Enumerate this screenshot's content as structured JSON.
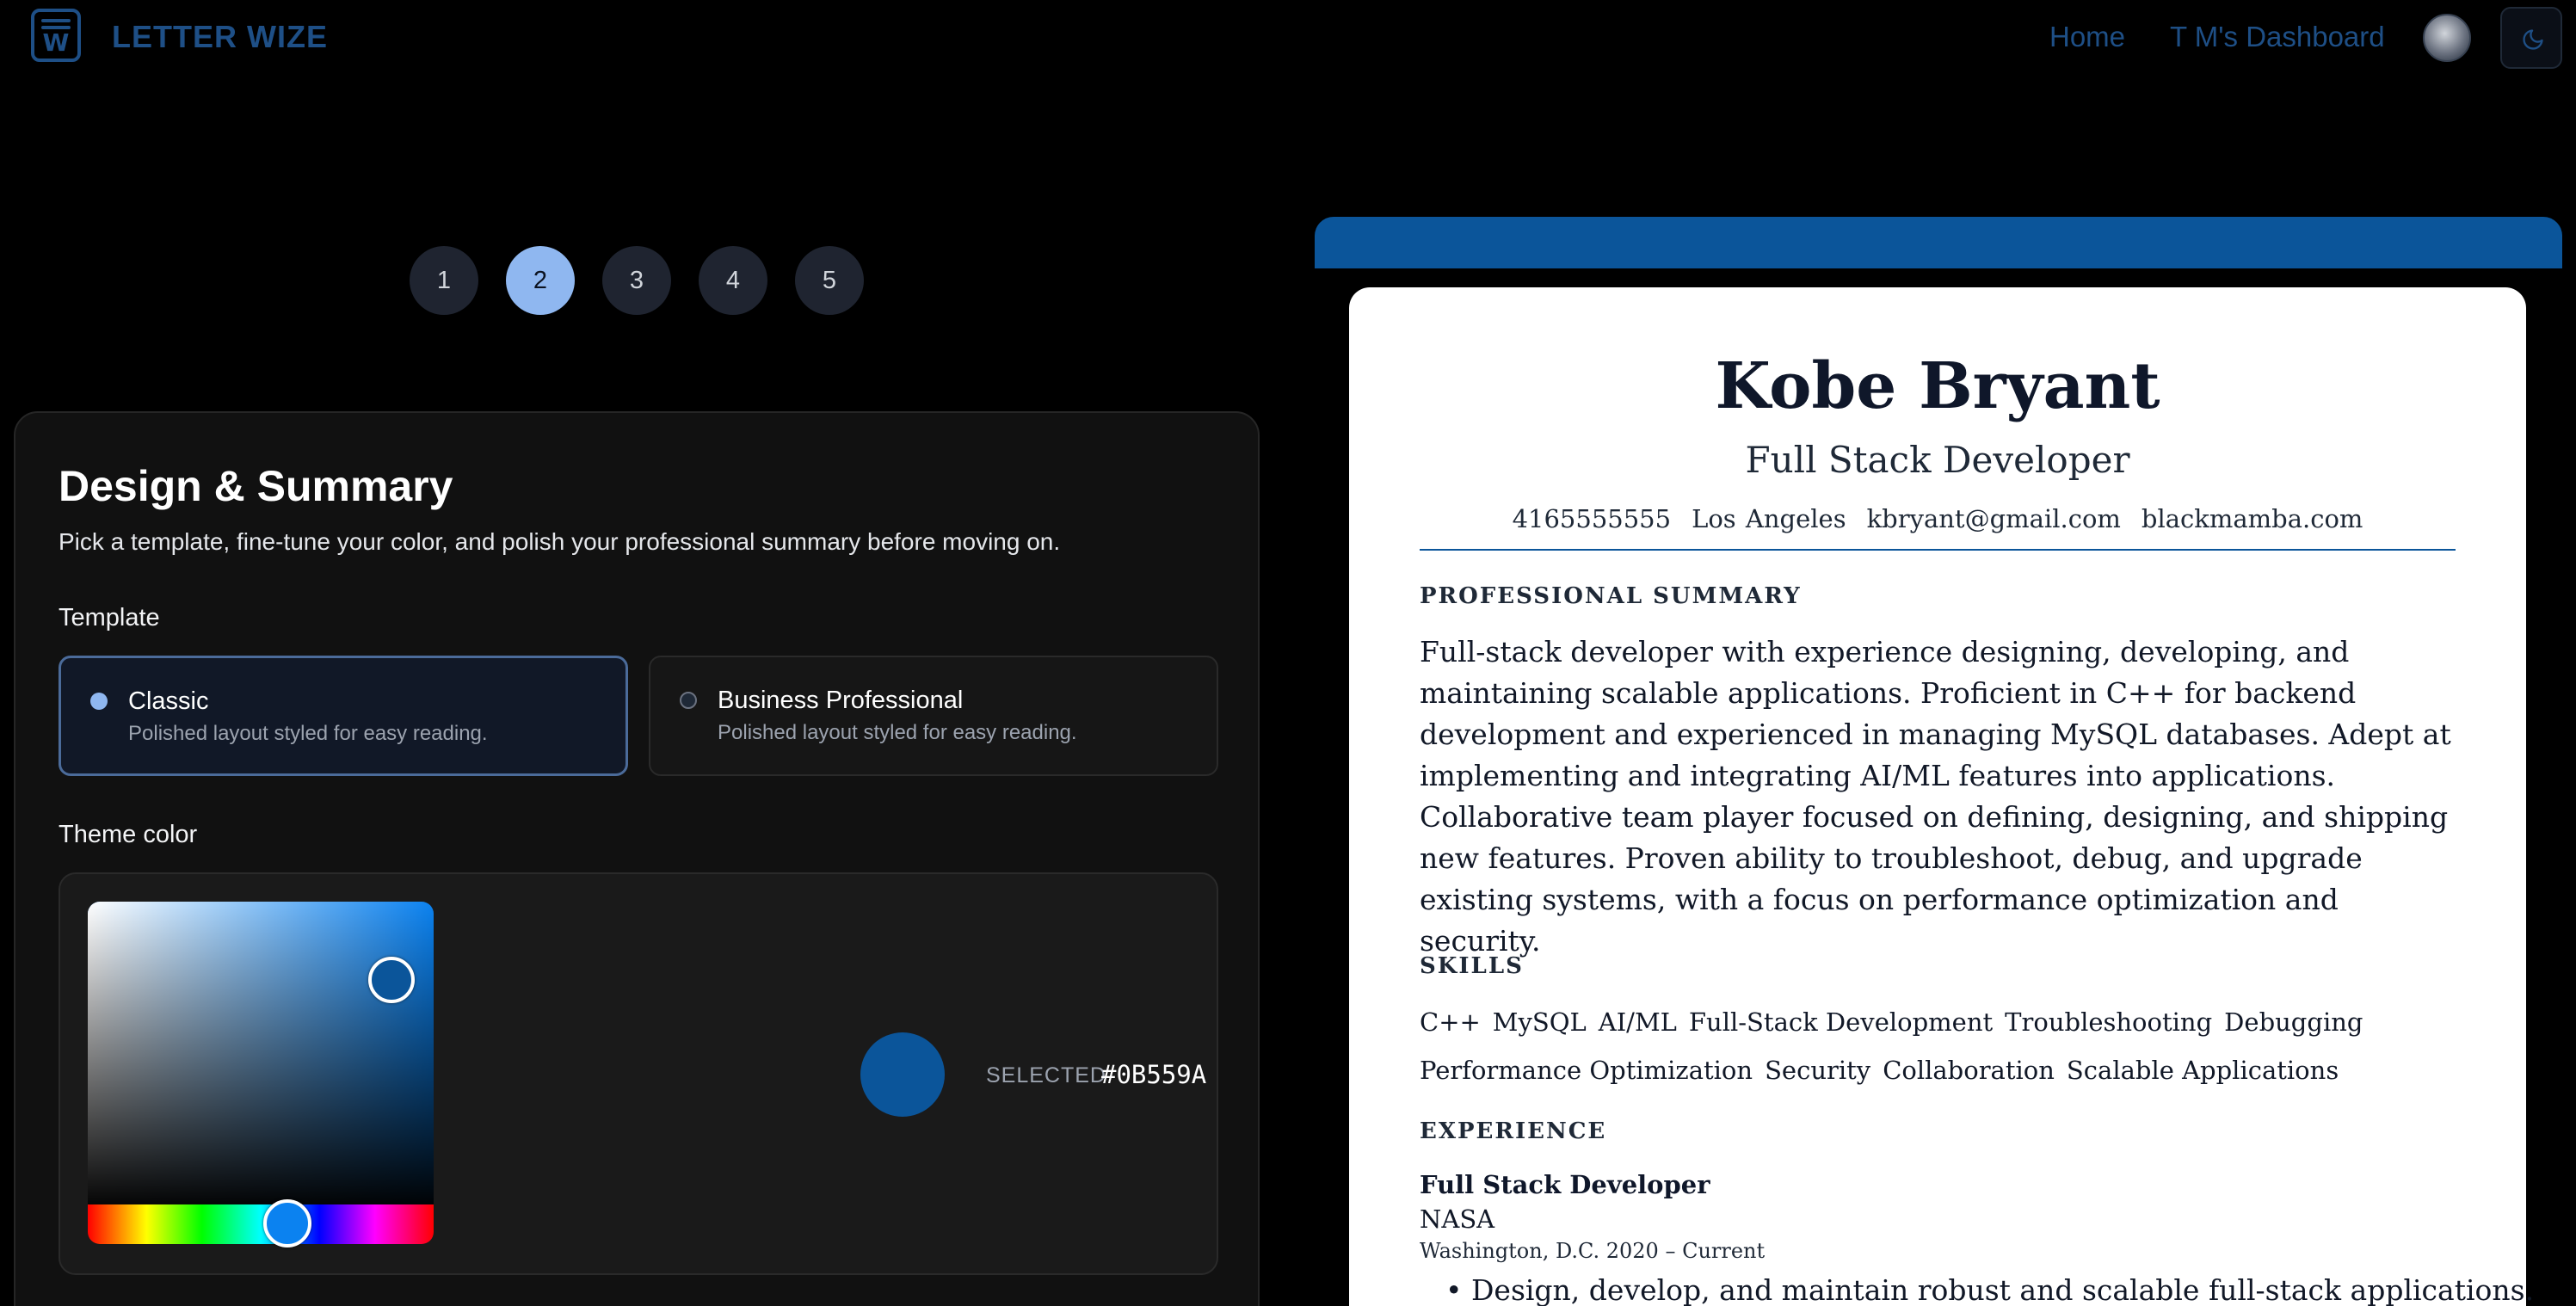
{
  "header": {
    "logo_letter": "W",
    "brand": "LETTER WIZE",
    "nav": {
      "home": "Home",
      "dashboard": "T M's Dashboard"
    }
  },
  "stepper": {
    "steps": [
      "1",
      "2",
      "3",
      "4",
      "5"
    ],
    "active": "2"
  },
  "form": {
    "title": "Design & Summary",
    "subtitle": "Pick a template, fine-tune your color, and polish your professional summary before moving on.",
    "template_label": "Template",
    "templates": [
      {
        "name": "Classic",
        "description": "Polished layout styled for easy reading.",
        "selected": true
      },
      {
        "name": "Business Professional",
        "description": "Polished layout styled for easy reading.",
        "selected": false
      }
    ],
    "theme_label": "Theme color",
    "theme": {
      "selected_label": "SELECTED",
      "selected_value": "#0B559A",
      "hue_color": "#0B82F0"
    }
  },
  "resume": {
    "name": "Kobe Bryant",
    "role": "Full Stack Developer",
    "contact": [
      "4165555555",
      "Los Angeles",
      "kbryant@gmail.com",
      "blackmamba.com"
    ],
    "summary_heading": "PROFESSIONAL SUMMARY",
    "summary": "Full-stack developer with experience designing, developing, and maintaining scalable applications. Proficient in C++ for backend development and experienced in managing MySQL databases. Adept at implementing and integrating AI/ML features into applications. Collaborative team player focused on defining, designing, and shipping new features. Proven ability to troubleshoot, debug, and upgrade existing systems, with a focus on performance optimization and security.",
    "skills_heading": "SKILLS",
    "skills": [
      "C++",
      "MySQL",
      "AI/ML",
      "Full-Stack Development",
      "Troubleshooting",
      "Debugging",
      "Performance Optimization",
      "Security",
      "Collaboration",
      "Scalable Applications"
    ],
    "experience_heading": "EXPERIENCE",
    "experience": [
      {
        "title": "Full Stack Developer",
        "company": "NASA",
        "meta": "Washington, D.C. 2020 – Current",
        "bullet": "• Design, develop, and maintain robust and scalable full-stack applications."
      }
    ]
  }
}
